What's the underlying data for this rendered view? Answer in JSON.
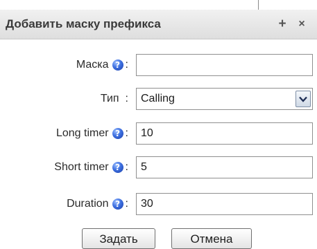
{
  "dialog": {
    "title": "Добавить маску префикса",
    "controls": {
      "add": "+",
      "close": "×"
    }
  },
  "fields": {
    "mask": {
      "label": "Маска",
      "value": ""
    },
    "type": {
      "label": "Тип",
      "value": "Calling"
    },
    "long_timer": {
      "label": "Long timer",
      "value": "10"
    },
    "short_timer": {
      "label": "Short timer",
      "value": "5"
    },
    "duration": {
      "label": "Duration",
      "value": "30"
    }
  },
  "punctuation": {
    "colon": ":"
  },
  "help_icon_glyph": "?",
  "buttons": {
    "submit": "Задать",
    "cancel": "Отмена"
  },
  "icons": {
    "help": "help-question-icon",
    "dropdown": "chevron-down-icon"
  },
  "colors": {
    "help_icon": "#2f5fd0",
    "title_bar": "#e6e6e6",
    "border": "#8f8f8f"
  }
}
